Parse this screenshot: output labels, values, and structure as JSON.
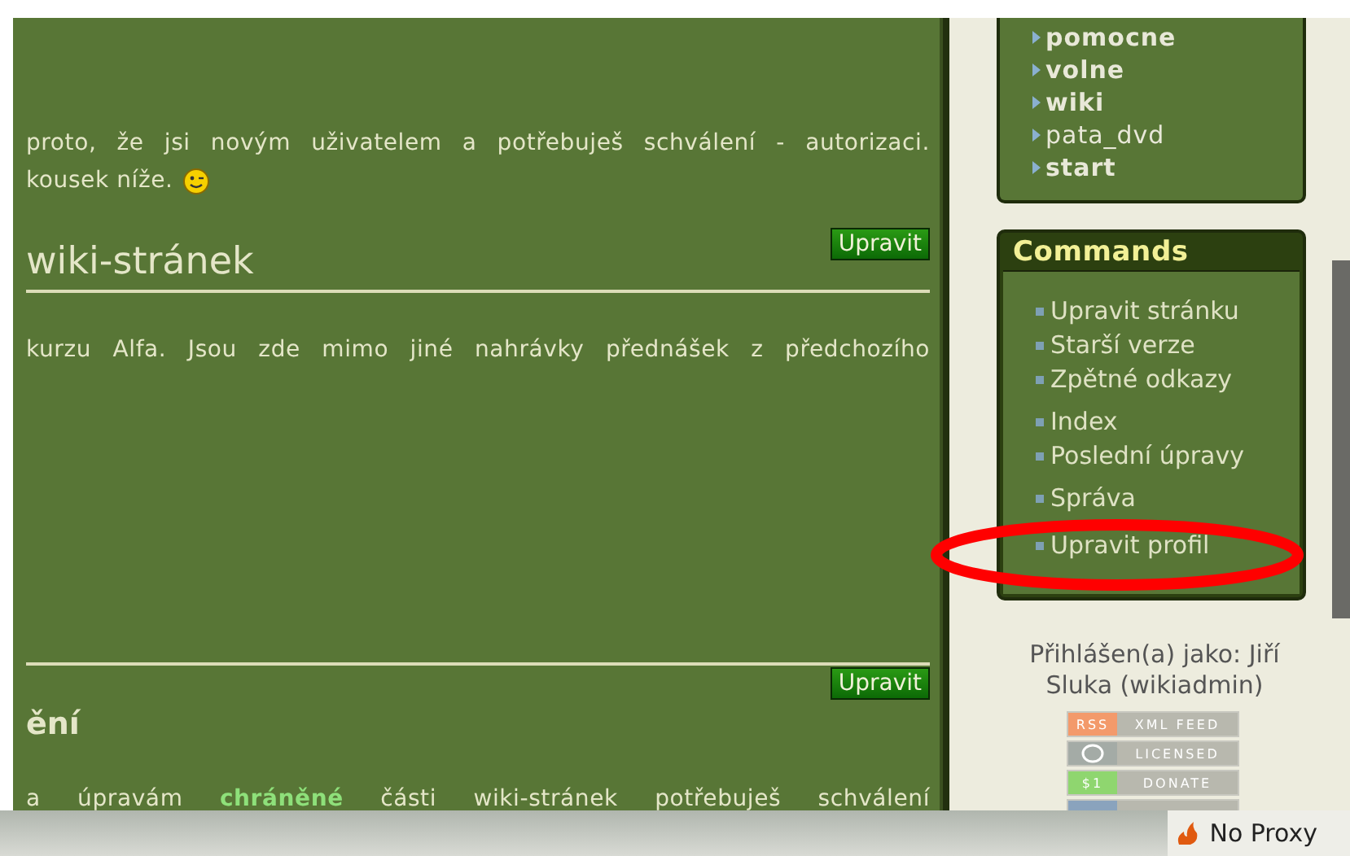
{
  "main": {
    "intro": [
      "proto, že jsi novým uživatelem a potřebuješ schválení - autorizaci.",
      "kousek níže."
    ],
    "sections": [
      {
        "kind": "h2",
        "edit": "Upravit",
        "title": "wiki-stránek",
        "text": "kurzu Alfa. Jsou zde mimo jiné nahrávky přednášek z předchozího"
      },
      {
        "kind": "h3",
        "edit": "Upravit",
        "title": "ění",
        "text": "a úpravám **chráněné** části wiki-stránek potřebuješ schválení"
      }
    ]
  },
  "sidebar": {
    "nav": [
      {
        "label": "pomocne",
        "bold": true
      },
      {
        "label": "volne",
        "bold": true
      },
      {
        "label": "wiki",
        "bold": true
      },
      {
        "label": "pata_dvd",
        "bold": false
      },
      {
        "label": "start",
        "bold": true
      }
    ],
    "commands": {
      "title": "Commands",
      "groups": [
        [
          "Upravit stránku",
          "Starší verze",
          "Zpětné odkazy"
        ],
        [
          "Index",
          "Poslední úpravy"
        ],
        [
          "Správa"
        ],
        [
          "Upravit profil"
        ]
      ]
    },
    "login": "Přihlášen(a) jako: Jiří Sluka (wikiadmin)",
    "badges": [
      {
        "kind": "text",
        "left": "RSS",
        "right": "XML FEED",
        "color": "#f39a6b"
      },
      {
        "kind": "cc",
        "right": "LICENSED",
        "color": "#a4aba6"
      },
      {
        "kind": "text",
        "left": "$1",
        "right": "DONATE",
        "color": "#8fd66f"
      },
      {
        "kind": "blank",
        "color": "#8aa3bd"
      }
    ]
  },
  "status_bar": {
    "proxy": "No Proxy"
  }
}
